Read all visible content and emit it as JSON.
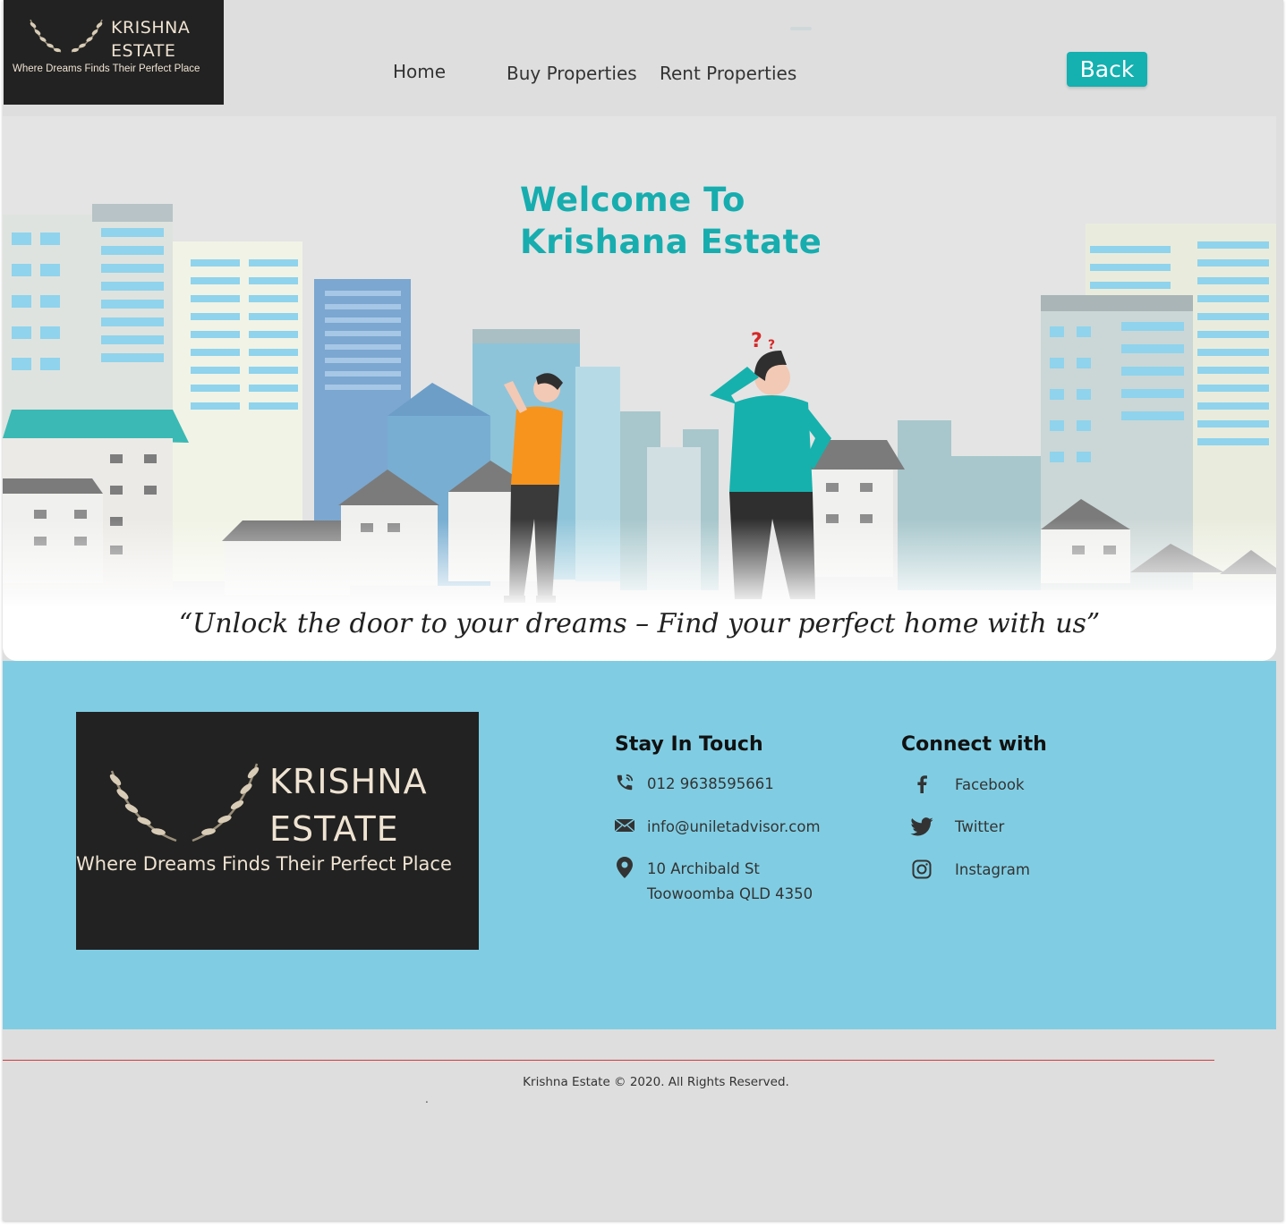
{
  "brand": {
    "name_line1": "KRISHNA",
    "name_line2": "ESTATE",
    "tagline": "Where Dreams Finds Their Perfect Place"
  },
  "nav": {
    "home": "Home",
    "buy": "Buy Properties",
    "rent": "Rent Properties",
    "back": "Back"
  },
  "hero": {
    "title_line1": "Welcome To",
    "title_line2": "Krishana Estate",
    "quote": "“Unlock the door to your dreams – Find your perfect home with us”"
  },
  "footer": {
    "stay_title": "Stay In Touch",
    "phone": "012 9638595661",
    "email": "info@uniletadvisor.com",
    "address_line1": "10 Archibald St",
    "address_line2": "Toowoomba QLD 4350",
    "connect_title": "Connect with",
    "facebook": "Facebook",
    "twitter": "Twitter",
    "instagram": "Instagram",
    "copyright": "Krishna Estate © 2020. All Rights Reserved.",
    "dot": "."
  },
  "icons": [
    "wreath-icon",
    "phone-icon",
    "mail-icon",
    "location-pin-icon",
    "facebook-icon",
    "twitter-icon",
    "instagram-icon"
  ],
  "colors": {
    "accent": "#15b0b0",
    "band": "#80cde3",
    "page_bg": "#dedede",
    "logo_bg": "#222222",
    "rule": "#d33a3a"
  }
}
